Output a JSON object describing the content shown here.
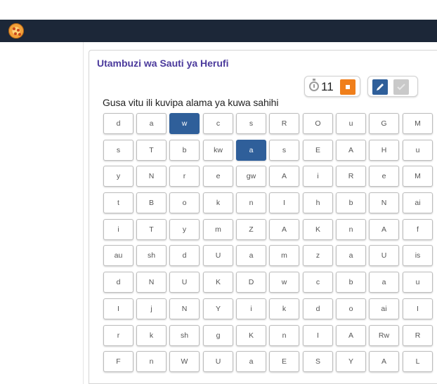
{
  "app": {
    "title": "Utambuzi wa Sauti ya Herufi",
    "instruction": "Gusa vitu ili kuvipa alama ya kuwa sahihi",
    "logo_icon": "pizza-logo-icon"
  },
  "toolbar": {
    "timer_value": "11",
    "timer_icon": "stopwatch-icon",
    "stop_icon": "stop-icon",
    "edit_icon": "pencil-icon",
    "check_icon": "check-icon"
  },
  "colors": {
    "navbar": "#1c2738",
    "title": "#4b3a9c",
    "selected_cell": "#2f5f9a",
    "stop_button": "#f07f1b"
  },
  "grid": [
    [
      "d",
      "a",
      "w",
      "c",
      "s",
      "R",
      "O",
      "u",
      "G",
      "M"
    ],
    [
      "s",
      "T",
      "b",
      "kw",
      "a",
      "s",
      "E",
      "A",
      "H",
      "u"
    ],
    [
      "y",
      "N",
      "r",
      "e",
      "gw",
      "A",
      "i",
      "R",
      "e",
      "M"
    ],
    [
      "t",
      "B",
      "o",
      "k",
      "n",
      "I",
      "h",
      "b",
      "N",
      "ai"
    ],
    [
      "i",
      "T",
      "y",
      "m",
      "Z",
      "A",
      "K",
      "n",
      "A",
      "f"
    ],
    [
      "au",
      "sh",
      "d",
      "U",
      "a",
      "m",
      "z",
      "a",
      "U",
      "is"
    ],
    [
      "d",
      "N",
      "U",
      "K",
      "D",
      "w",
      "c",
      "b",
      "a",
      "u"
    ],
    [
      "I",
      "j",
      "N",
      "Y",
      "i",
      "k",
      "d",
      "o",
      "ai",
      "I"
    ],
    [
      "r",
      "k",
      "sh",
      "g",
      "K",
      "n",
      "I",
      "A",
      "Rw",
      "R"
    ],
    [
      "F",
      "n",
      "W",
      "U",
      "a",
      "E",
      "S",
      "Y",
      "A",
      "L"
    ]
  ],
  "selected": [
    [
      0,
      2
    ],
    [
      1,
      4
    ]
  ]
}
